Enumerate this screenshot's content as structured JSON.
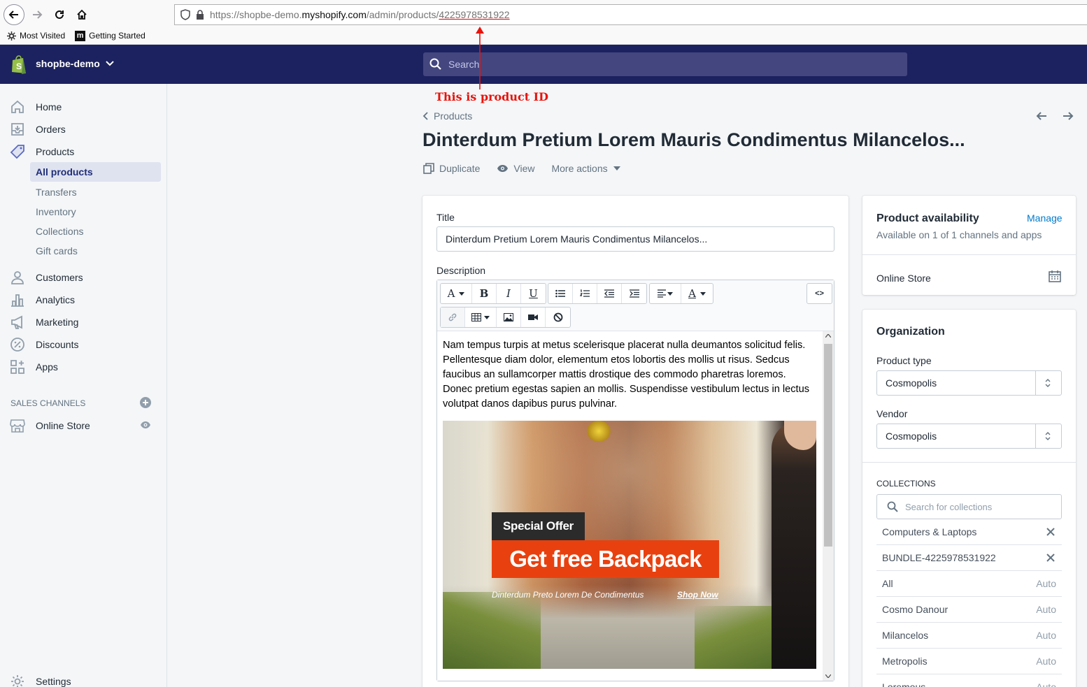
{
  "browser": {
    "url_prefix": "https://shopbe-demo.",
    "url_host": "myshopify.com",
    "url_path": "/admin/products/",
    "url_product_id": "4225978531922",
    "bookmarks": [
      {
        "label": "Most Visited",
        "icon": "gear-icon"
      },
      {
        "label": "Getting Started",
        "icon": "m-logo-icon"
      }
    ]
  },
  "topbar": {
    "store_name": "shopbe-demo",
    "search_placeholder": "Search",
    "colors": {
      "background": "#1c2260",
      "search_bg": "#43467f"
    }
  },
  "sidebar": {
    "items": [
      {
        "label": "Home",
        "icon": "home-icon"
      },
      {
        "label": "Orders",
        "icon": "orders-icon"
      },
      {
        "label": "Products",
        "icon": "tag-icon"
      }
    ],
    "product_subitems": [
      {
        "label": "All products",
        "active": true
      },
      {
        "label": "Transfers"
      },
      {
        "label": "Inventory"
      },
      {
        "label": "Collections"
      },
      {
        "label": "Gift cards"
      }
    ],
    "items2": [
      {
        "label": "Customers",
        "icon": "person-icon"
      },
      {
        "label": "Analytics",
        "icon": "bar-chart-icon"
      },
      {
        "label": "Marketing",
        "icon": "megaphone-icon"
      },
      {
        "label": "Discounts",
        "icon": "discount-icon"
      },
      {
        "label": "Apps",
        "icon": "apps-icon"
      }
    ],
    "sales_channels_heading": "SALES CHANNELS",
    "online_store": "Online Store",
    "settings": "Settings"
  },
  "annotation": {
    "text": "This is product ID",
    "color": "#e8140c"
  },
  "page": {
    "breadcrumb": "Products",
    "title": "Dinterdum Pretium Lorem Mauris Condimentus Milancelos...",
    "actions": {
      "duplicate": "Duplicate",
      "view": "View",
      "more": "More actions"
    }
  },
  "product_form": {
    "title_label": "Title",
    "title_value": "Dinterdum Pretium Lorem Mauris Condimentus Milancelos...",
    "description_label": "Description",
    "description_text": "Nam tempus turpis at metus scelerisque placerat nulla deumantos solicitud felis. Pellentesque diam dolor, elementum etos lobortis des mollis ut risus. Sedcus faucibus an sullamcorper mattis drostique des commodo pharetras loremos. Donec pretium egestas sapien an mollis. Suspendisse vestibulum lectus in lectus volutpat danos dapibus purus pulvinar.",
    "toolbar": {
      "bold": "B",
      "italic": "I",
      "underline": "U",
      "font": "A",
      "color": "A",
      "html": "<>"
    },
    "banner": {
      "special_offer": "Special Offer",
      "headline": "Get free Backpack",
      "subtext": "Dinterdum Preto Lorem De Condimentus",
      "cta": "Shop Now",
      "accent": "#e8410f"
    }
  },
  "availability": {
    "title": "Product availability",
    "manage": "Manage",
    "subtitle": "Available on 1 of 1 channels and apps",
    "channel": "Online Store"
  },
  "organization": {
    "title": "Organization",
    "product_type_label": "Product type",
    "product_type_value": "Cosmopolis",
    "vendor_label": "Vendor",
    "vendor_value": "Cosmopolis",
    "collections_heading": "COLLECTIONS",
    "collections_placeholder": "Search for collections",
    "collections": [
      {
        "name": "Computers & Laptops",
        "removable": true
      },
      {
        "name": "BUNDLE-4225978531922",
        "removable": true
      },
      {
        "name": "All",
        "tag": "Auto"
      },
      {
        "name": "Cosmo Danour",
        "tag": "Auto"
      },
      {
        "name": "Milancelos",
        "tag": "Auto"
      },
      {
        "name": "Metropolis",
        "tag": "Auto"
      },
      {
        "name": "Loremous",
        "tag": "Auto"
      }
    ]
  }
}
